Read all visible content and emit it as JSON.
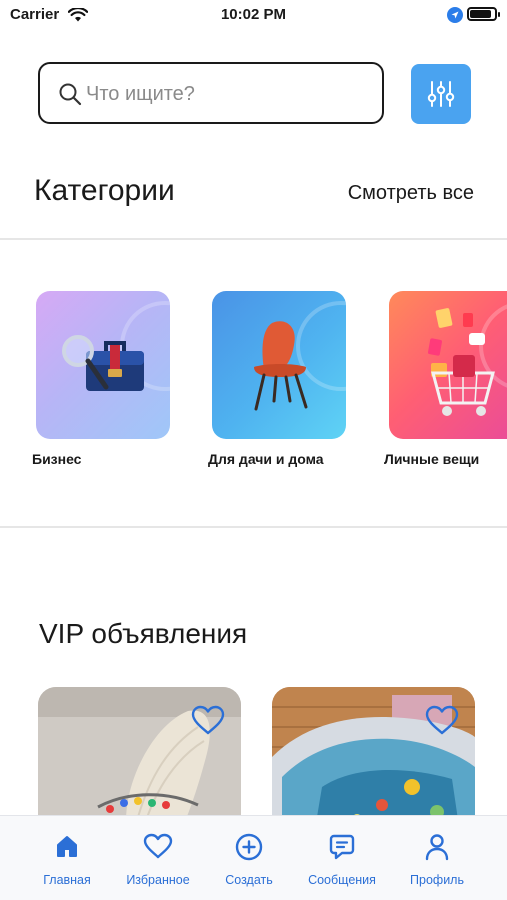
{
  "status_bar": {
    "carrier": "Carrier",
    "time": "10:02 PM",
    "battery_level": 0.9
  },
  "search": {
    "placeholder": "Что ищите?",
    "value": ""
  },
  "categories": {
    "title": "Категории",
    "see_all": "Смотреть все",
    "items": [
      {
        "label": "Бизнес"
      },
      {
        "label": "Для дачи и дома"
      },
      {
        "label": "Личные вещи"
      }
    ]
  },
  "vip": {
    "title": "VIP объявления",
    "listings": [
      {
        "favorite": false
      },
      {
        "favorite": false
      }
    ]
  },
  "tab_bar": {
    "active": "home",
    "items": [
      {
        "id": "home",
        "label": "Главная",
        "icon": "home-icon"
      },
      {
        "id": "favorites",
        "label": "Избранное",
        "icon": "heart-icon"
      },
      {
        "id": "create",
        "label": "Создать",
        "icon": "plus-circle-icon"
      },
      {
        "id": "messages",
        "label": "Сообщения",
        "icon": "message-icon"
      },
      {
        "id": "profile",
        "label": "Профиль",
        "icon": "profile-icon"
      }
    ]
  },
  "colors": {
    "accent": "#2b6fd6",
    "filter_button": "#4aa3f0"
  }
}
